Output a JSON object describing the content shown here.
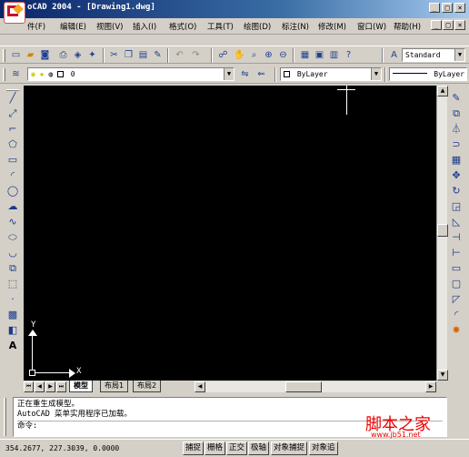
{
  "window": {
    "title": "oCAD 2004 - [Drawing1.dwg]",
    "controls": {
      "minimize": "_",
      "restore": "□",
      "close": "×"
    }
  },
  "menu": {
    "items": [
      "件(F)",
      "编辑(E)",
      "视图(V)",
      "插入(I)",
      "格式(O)",
      "工具(T)",
      "绘图(D)",
      "标注(N)",
      "修改(M)",
      "窗口(W)",
      "帮助(H)"
    ]
  },
  "toolbar": {
    "text_style": "Standard",
    "layer": "0",
    "color": "ByLayer",
    "linetype": "ByLayer"
  },
  "layout_tabs": [
    "模型",
    "布局1",
    "布局2"
  ],
  "command": {
    "history": [
      "正在重生成模型。",
      "AutoCAD 菜单实用程序已加载。"
    ],
    "prompt": "命令:"
  },
  "ucs": {
    "x_label": "X",
    "y_label": "Y"
  },
  "status": {
    "coordinates": "354.2677, 227.3039, 0.0000",
    "buttons": [
      "捕捉",
      "栅格",
      "正交",
      "极轴",
      "对象捕捉",
      "对象追"
    ]
  },
  "watermark": {
    "text": "脚本之家",
    "url": "www.jb51.net"
  }
}
